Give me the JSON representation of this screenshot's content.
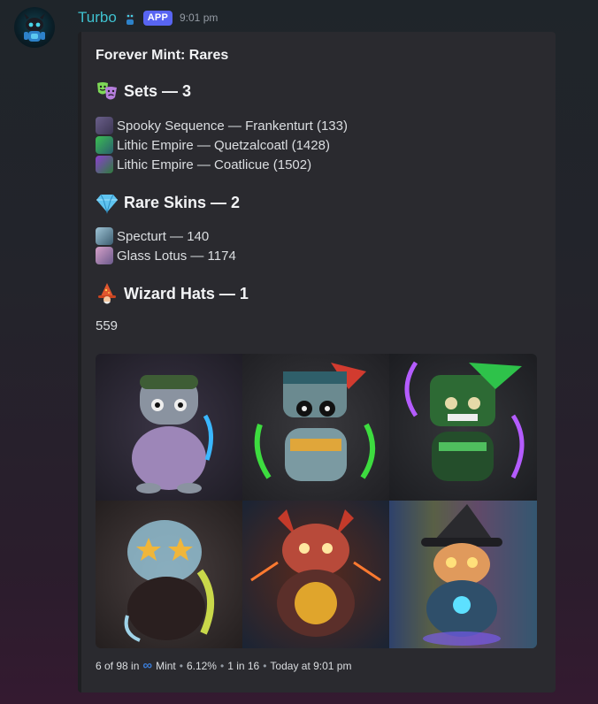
{
  "message": {
    "username": "Turbo",
    "app_badge": "APP",
    "timestamp": "9:01 pm"
  },
  "embed": {
    "title": "Forever Mint: Rares",
    "sets": {
      "heading": "Sets — 3",
      "emoji": "theater-masks-icon",
      "items": [
        "Spooky Sequence — Frankenturt (133)",
        "Lithic Empire — Quetzalcoatl (1428)",
        "Lithic Empire — Coatlicue (1502)"
      ]
    },
    "skins": {
      "heading": "Rare Skins — 2",
      "emoji": "gem-icon",
      "items": [
        "Specturt — 140",
        "Glass Lotus — 1174"
      ]
    },
    "hats": {
      "heading": "Wizard Hats — 1",
      "emoji": "wizard-icon",
      "value": "559"
    },
    "gallery": [
      "frankenturt-image",
      "quetzalcoatl-image",
      "coatlicue-image",
      "ghost-turtle-image",
      "demon-turtle-image",
      "wizard-turtle-image"
    ],
    "footer": {
      "prefix": "6 of 98 in",
      "mint": "Mint",
      "percent": "6.12%",
      "odds": "1 in 16",
      "time": "Today at 9:01 pm",
      "separator": "•",
      "infinity_icon": "∞"
    }
  },
  "colors": {
    "username": "#3fc1cf",
    "badge": "#5865f2",
    "embed_bg": "#2a2a2f"
  }
}
